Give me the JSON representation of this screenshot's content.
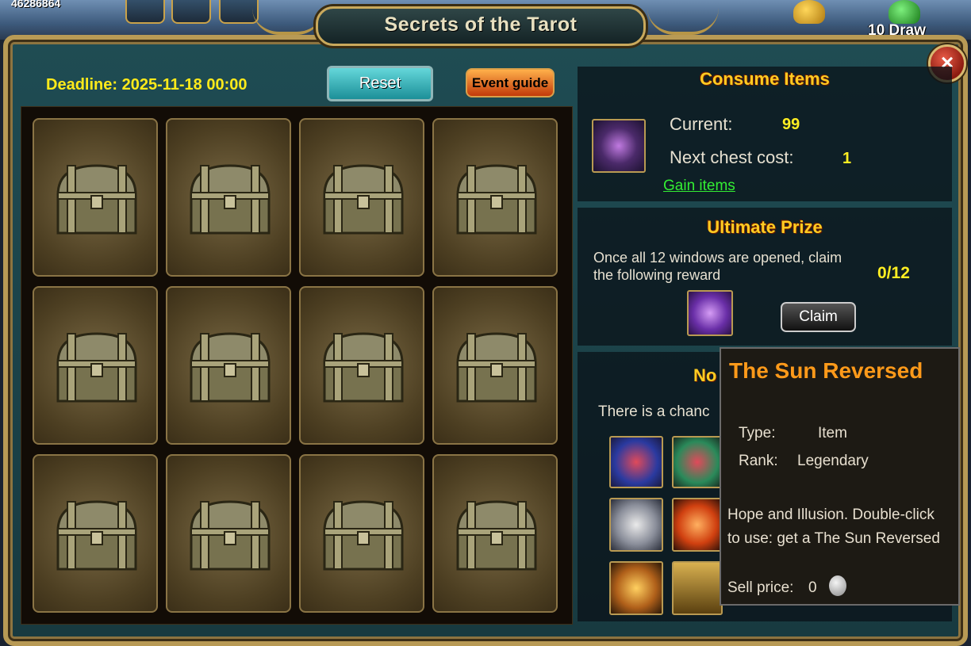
{
  "top": {
    "score": "46286864",
    "draw_label": "10 Draw"
  },
  "window": {
    "title": "Secrets of the Tarot",
    "close_glyph": "×"
  },
  "controls": {
    "deadline": "Deadline: 2025-11-18 00:00",
    "reset_label": "Reset",
    "guide_label": "Event guide"
  },
  "chests": {
    "count": 12,
    "icon": "treasure-chest-icon"
  },
  "consume": {
    "title": "Consume Items",
    "current_label": "Current:",
    "current_value": "99",
    "next_cost_label": "Next chest cost:",
    "next_cost_value": "1",
    "gain_link": "Gain items",
    "item_icon": "tarot-card-icon"
  },
  "ultimate": {
    "title": "Ultimate Prize",
    "description": "Once all 12 windows are opened, claim the following reward",
    "progress": "0/12",
    "claim_label": "Claim",
    "reward_icon": "purple-chest-icon"
  },
  "normal": {
    "title_visible": "No",
    "chance_text_visible": "There is a chanc"
  },
  "tooltip": {
    "title": "The Sun Reversed",
    "type_label": "Type:",
    "type_value": "Item",
    "rank_label": "Rank:",
    "rank_value": "Legendary",
    "desc_line1": "Hope and Illusion. Double-click",
    "desc_line2": "to use: get a The Sun Reversed",
    "sell_label": "Sell price:",
    "sell_value": "0",
    "coin_icon": "silver-coin-icon"
  },
  "colors": {
    "accent_gold": "#ffcc22",
    "deadline_yellow": "#ffea1a",
    "link_green": "#33ee33",
    "tooltip_title": "#ff9a1a"
  }
}
